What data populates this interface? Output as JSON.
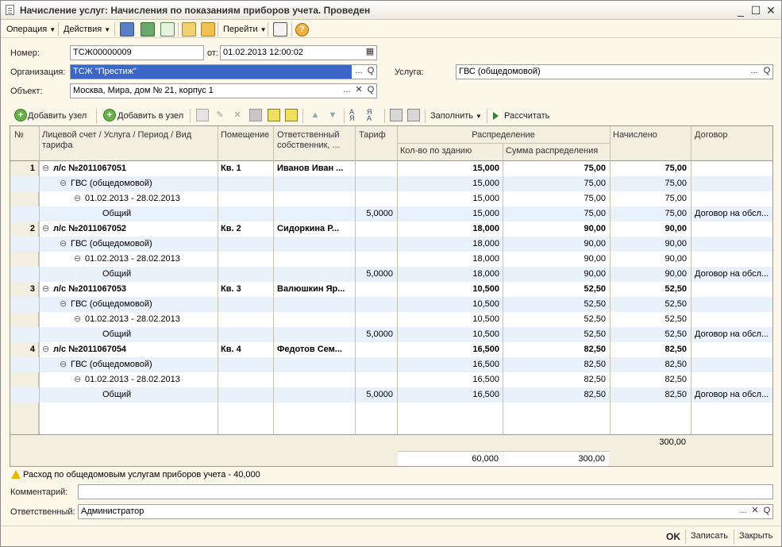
{
  "window": {
    "title": "Начисление услуг: Начисления по показаниям приборов учета. Проведен",
    "min": "_",
    "max": "☐",
    "close": "✕"
  },
  "menu": {
    "operation": "Операция",
    "actions": "Действия",
    "goto": "Перейти",
    "help": "?"
  },
  "form": {
    "number_label": "Номер:",
    "number_value": "ТСЖ00000009",
    "from_label": "от:",
    "date_value": "01.02.2013 12:00:02",
    "org_label": "Организация:",
    "org_value": "ТСЖ \"Престиж\"",
    "service_label": "Услуга:",
    "service_value": "ГВС (общедомовой)",
    "object_label": "Объект:",
    "object_value": "Москва, Мира, дом № 21, корпус 1",
    "btn_dots": "...",
    "btn_clear": "✕",
    "btn_search": "Q",
    "btn_cal": "▦"
  },
  "toolbar": {
    "add_node": "Добавить узел",
    "add_into_node": "Добавить в узел",
    "fill": "Заполнить",
    "calculate": "Рассчитать"
  },
  "table": {
    "headers": {
      "num": "№",
      "account_l1": "Лицевой счет / Услуга / Период / Вид",
      "account_l2": "тарифа",
      "room": "Помещение",
      "owner_l1": "Ответственный",
      "owner_l2": "собственник, ...",
      "tariff": "Тариф",
      "distribution": "Распределение",
      "qty_building": "Кол-во по зданию",
      "sum_distribution": "Сумма распределения",
      "charged": "Начислено",
      "contract": "Договор"
    },
    "rows": [
      {
        "n": "1",
        "level": 0,
        "text": "л/с №2011067051",
        "room": "Кв. 1",
        "owner": "Иванов Иван ...",
        "tariff": "",
        "qty": "15,000",
        "sum": "75,00",
        "charged": "75,00",
        "contract": "",
        "bold": true
      },
      {
        "n": "",
        "level": 1,
        "text": "ГВС (общедомовой)",
        "room": "",
        "owner": "",
        "tariff": "",
        "qty": "15,000",
        "sum": "75,00",
        "charged": "75,00",
        "contract": ""
      },
      {
        "n": "",
        "level": 2,
        "text": "01.02.2013 - 28.02.2013",
        "room": "",
        "owner": "",
        "tariff": "",
        "qty": "15,000",
        "sum": "75,00",
        "charged": "75,00",
        "contract": ""
      },
      {
        "n": "",
        "level": 3,
        "text": "Общий",
        "room": "",
        "owner": "",
        "tariff": "5,0000",
        "qty": "15,000",
        "sum": "75,00",
        "charged": "75,00",
        "contract": "Договор на обсл..."
      },
      {
        "n": "2",
        "level": 0,
        "text": "л/с №2011067052",
        "room": "Кв. 2",
        "owner": "Сидоркина Р...",
        "tariff": "",
        "qty": "18,000",
        "sum": "90,00",
        "charged": "90,00",
        "contract": "",
        "bold": true
      },
      {
        "n": "",
        "level": 1,
        "text": "ГВС (общедомовой)",
        "room": "",
        "owner": "",
        "tariff": "",
        "qty": "18,000",
        "sum": "90,00",
        "charged": "90,00",
        "contract": ""
      },
      {
        "n": "",
        "level": 2,
        "text": "01.02.2013 - 28.02.2013",
        "room": "",
        "owner": "",
        "tariff": "",
        "qty": "18,000",
        "sum": "90,00",
        "charged": "90,00",
        "contract": ""
      },
      {
        "n": "",
        "level": 3,
        "text": "Общий",
        "room": "",
        "owner": "",
        "tariff": "5,0000",
        "qty": "18,000",
        "sum": "90,00",
        "charged": "90,00",
        "contract": "Договор на обсл..."
      },
      {
        "n": "3",
        "level": 0,
        "text": "л/с №2011067053",
        "room": "Кв. 3",
        "owner": "Валюшкин Яр...",
        "tariff": "",
        "qty": "10,500",
        "sum": "52,50",
        "charged": "52,50",
        "contract": "",
        "bold": true
      },
      {
        "n": "",
        "level": 1,
        "text": "ГВС (общедомовой)",
        "room": "",
        "owner": "",
        "tariff": "",
        "qty": "10,500",
        "sum": "52,50",
        "charged": "52,50",
        "contract": ""
      },
      {
        "n": "",
        "level": 2,
        "text": "01.02.2013 - 28.02.2013",
        "room": "",
        "owner": "",
        "tariff": "",
        "qty": "10,500",
        "sum": "52,50",
        "charged": "52,50",
        "contract": ""
      },
      {
        "n": "",
        "level": 3,
        "text": "Общий",
        "room": "",
        "owner": "",
        "tariff": "5,0000",
        "qty": "10,500",
        "sum": "52,50",
        "charged": "52,50",
        "contract": "Договор на обсл..."
      },
      {
        "n": "4",
        "level": 0,
        "text": "л/с №2011067054",
        "room": "Кв. 4",
        "owner": "Федотов Сем...",
        "tariff": "",
        "qty": "16,500",
        "sum": "82,50",
        "charged": "82,50",
        "contract": "",
        "bold": true
      },
      {
        "n": "",
        "level": 1,
        "text": "ГВС (общедомовой)",
        "room": "",
        "owner": "",
        "tariff": "",
        "qty": "16,500",
        "sum": "82,50",
        "charged": "82,50",
        "contract": ""
      },
      {
        "n": "",
        "level": 2,
        "text": "01.02.2013 - 28.02.2013",
        "room": "",
        "owner": "",
        "tariff": "",
        "qty": "16,500",
        "sum": "82,50",
        "charged": "82,50",
        "contract": ""
      },
      {
        "n": "",
        "level": 3,
        "text": "Общий",
        "room": "",
        "owner": "",
        "tariff": "5,0000",
        "qty": "16,500",
        "sum": "82,50",
        "charged": "82,50",
        "contract": "Договор на обсл..."
      }
    ],
    "totals": {
      "charged": "300,00",
      "qty": "60,000",
      "sum": "300,00"
    }
  },
  "warning": "Расход по общедомовым услугам приборов учета - 40,000",
  "comment_label": "Комментарий:",
  "comment_value": "",
  "responsible_label": "Ответственный:",
  "responsible_value": "Администратор",
  "bottom": {
    "ok": "OK",
    "save": "Записать",
    "close": "Закрыть"
  },
  "colors": {
    "selection": "#3c67c6",
    "row_alt": "#e9f2fb",
    "header_bg": "#f2efe0",
    "window_bg": "#fbf8ea"
  }
}
